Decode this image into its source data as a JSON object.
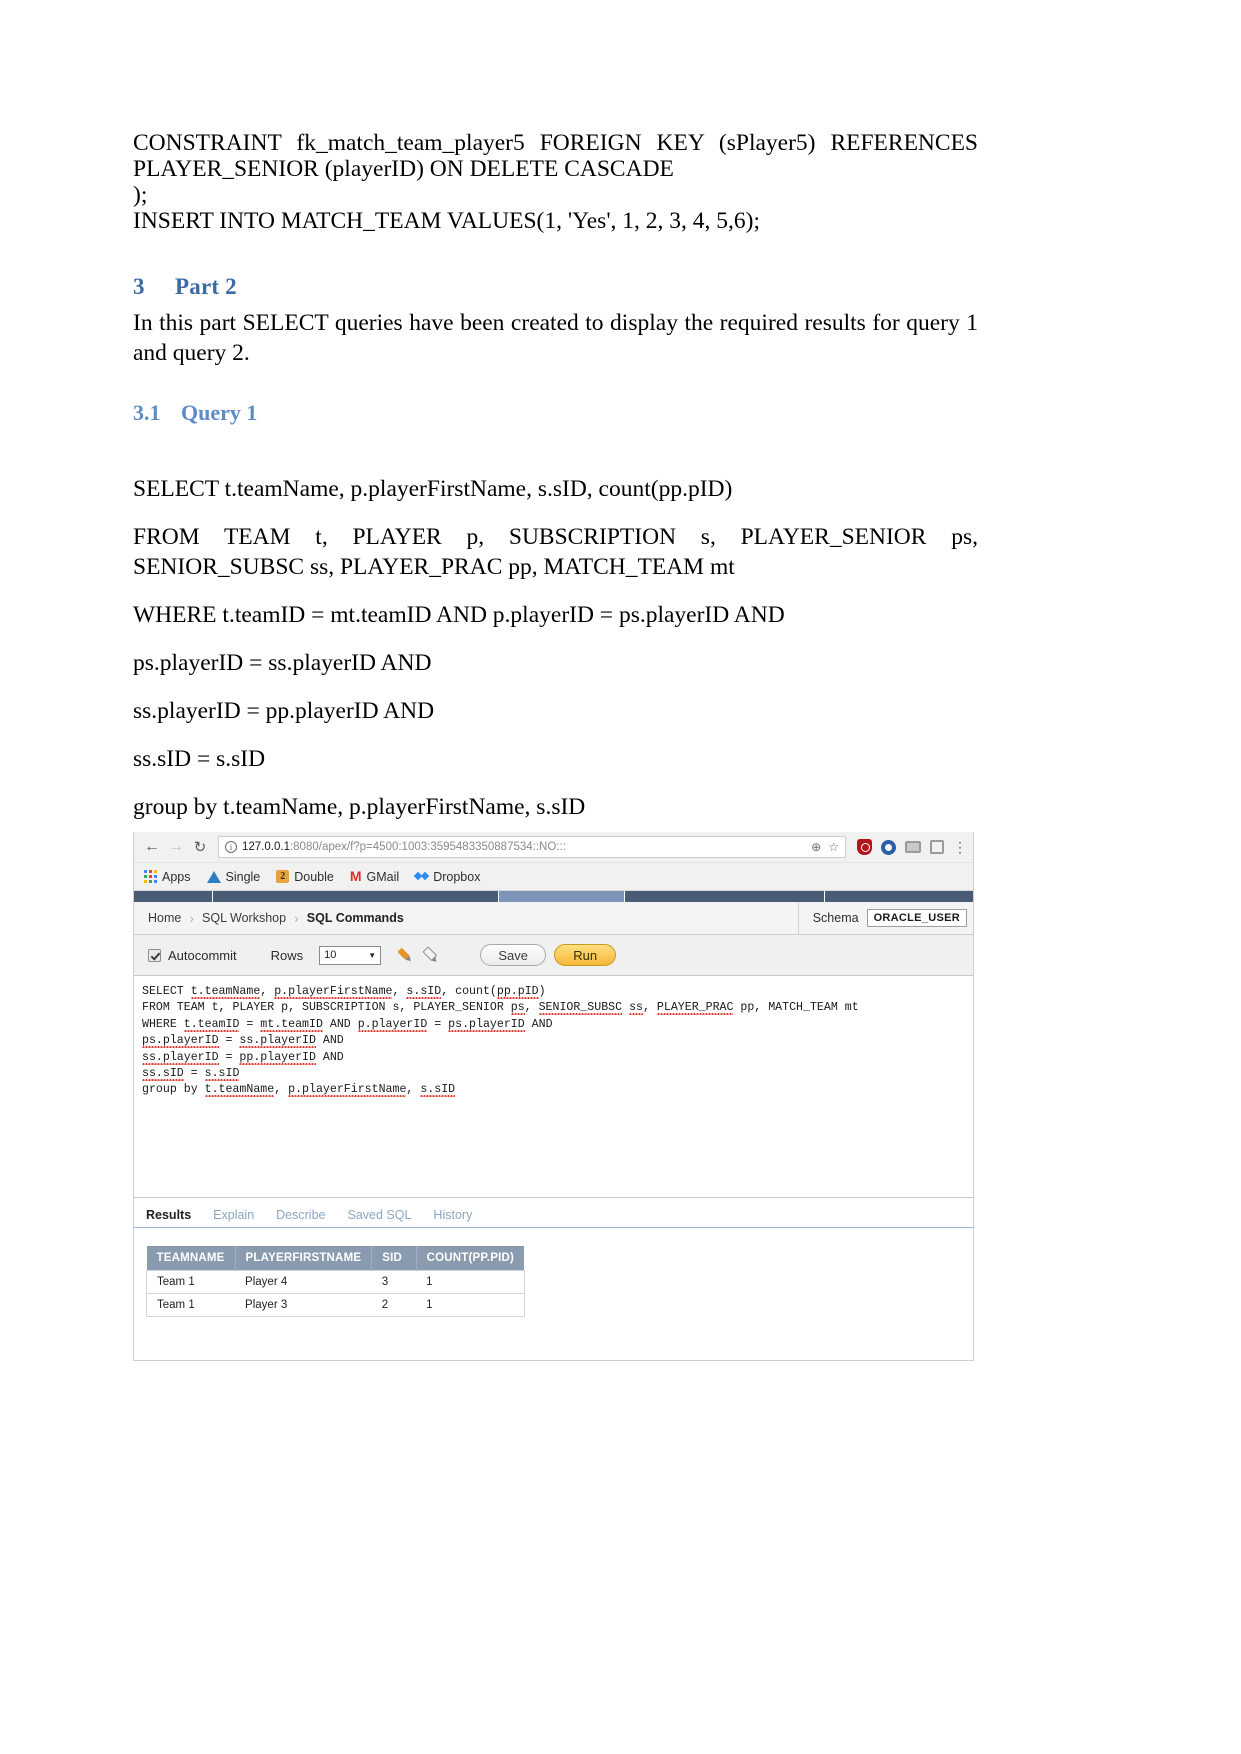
{
  "document": {
    "top_code": {
      "line1": "CONSTRAINT  fk_match_team_player5    FOREIGN  KEY  (sPlayer5)  REFERENCES",
      "line2": "PLAYER_SENIOR (playerID) ON DELETE CASCADE",
      "line3": ");",
      "line4": "INSERT INTO MATCH_TEAM VALUES(1, 'Yes', 1, 2, 3, 4, 5,6);"
    },
    "section": {
      "number": "3",
      "title": "Part 2",
      "paragraph": "In this part SELECT queries have been created to display the required results for query 1 and query 2."
    },
    "subsection": {
      "number": "3.1",
      "title": "Query 1"
    },
    "query_lines": {
      "l1": "SELECT t.teamName, p.playerFirstName, s.sID, count(pp.pID)",
      "l2": "FROM TEAM t, PLAYER p, SUBSCRIPTION s, PLAYER_SENIOR ps, SENIOR_SUBSC ss, PLAYER_PRAC pp, MATCH_TEAM mt",
      "l3": "WHERE t.teamID = mt.teamID AND p.playerID = ps.playerID AND",
      "l4": "ps.playerID = ss.playerID AND",
      "l5": "ss.playerID = pp.playerID AND",
      "l6": "ss.sID = s.sID",
      "l7": "group by t.teamName, p.playerFirstName, s.sID"
    }
  },
  "browser": {
    "back_glyph": "←",
    "forward_glyph": "→",
    "reload_glyph": "↻",
    "url_host": "127.0.0.1",
    "url_rest": ":8080/apex/f?p=4500:1003:3595483350887534::NO:::",
    "zoom_glyph": "⊕",
    "star_glyph": "☆",
    "menu_glyph": "⋮",
    "bookmarks": [
      {
        "label": "Apps",
        "icon": "apps-grid-icon"
      },
      {
        "label": "Single",
        "icon": "blue-triangle-icon"
      },
      {
        "label": "Double",
        "icon": "orange-square-icon"
      },
      {
        "label": "GMail",
        "icon": "gmail-m-icon"
      },
      {
        "label": "Dropbox",
        "icon": "dropbox-icon"
      }
    ]
  },
  "apex": {
    "breadcrumb": [
      {
        "label": "Home",
        "current": false
      },
      {
        "label": "SQL Workshop",
        "current": false
      },
      {
        "label": "SQL Commands",
        "current": true
      }
    ],
    "crumb_separator": "›",
    "schema_label": "Schema",
    "schema_value": "ORACLE_USER",
    "toolbar": {
      "autocommit_label": "Autocommit",
      "rows_label": "Rows",
      "rows_value": "10",
      "caret_glyph": "▼",
      "save_label": "Save",
      "run_label": "Run"
    },
    "editor": {
      "line1_a": "SELECT ",
      "line1_b": "t.teamName",
      "line1_c": ", ",
      "line1_d": "p.playerFirstName",
      "line1_e": ", ",
      "line1_f": "s.sID",
      "line1_g": ", count(",
      "line1_h": "pp.pID",
      "line1_i": ")",
      "line2_a": "FROM TEAM t, PLAYER p, SUBSCRIPTION s, PLAYER_SENIOR ",
      "line2_b": "ps",
      "line2_c": ", ",
      "line2_d": "SENIOR_SUBSC",
      "line2_e": " ",
      "line2_f": "ss",
      "line2_g": ", ",
      "line2_h": "PLAYER_PRAC",
      "line2_i": " pp, MATCH_TEAM mt",
      "line3_a": "WHERE ",
      "line3_b": "t.teamID",
      "line3_c": " = ",
      "line3_d": "mt.teamID",
      "line3_e": " AND ",
      "line3_f": "p.playerID",
      "line3_g": " = ",
      "line3_h": "ps.playerID",
      "line3_i": " AND",
      "line4_a": "ps.playerID",
      "line4_b": " = ",
      "line4_c": "ss.playerID",
      "line4_d": " AND",
      "line5_a": "ss.playerID",
      "line5_b": " = ",
      "line5_c": "pp.playerID",
      "line5_d": " AND",
      "line6_a": "ss.sID",
      "line6_b": " = ",
      "line6_c": "s.sID",
      "line7_a": "group by ",
      "line7_b": "t.teamName",
      "line7_c": ", ",
      "line7_d": "p.playerFirstName",
      "line7_e": ", ",
      "line7_f": "s.sID"
    },
    "tabs": [
      {
        "label": "Results",
        "active": true
      },
      {
        "label": "Explain",
        "active": false
      },
      {
        "label": "Describe",
        "active": false
      },
      {
        "label": "Saved SQL",
        "active": false
      },
      {
        "label": "History",
        "active": false
      }
    ],
    "results_table": {
      "columns": [
        "TEAMNAME",
        "PLAYERFIRSTNAME",
        "SID",
        "COUNT(PP.PID)"
      ],
      "rows": [
        [
          "Team 1",
          "Player 4",
          "3",
          "1"
        ],
        [
          "Team 1",
          "Player 3",
          "2",
          "1"
        ]
      ]
    }
  },
  "colors": {
    "heading_blue": "#3a6ba5",
    "subheading_blue": "#5b8cc8",
    "apex_navy": "#4a5c75",
    "run_yellow": "#f5b73a",
    "table_header_gray": "#8a9bb0"
  }
}
